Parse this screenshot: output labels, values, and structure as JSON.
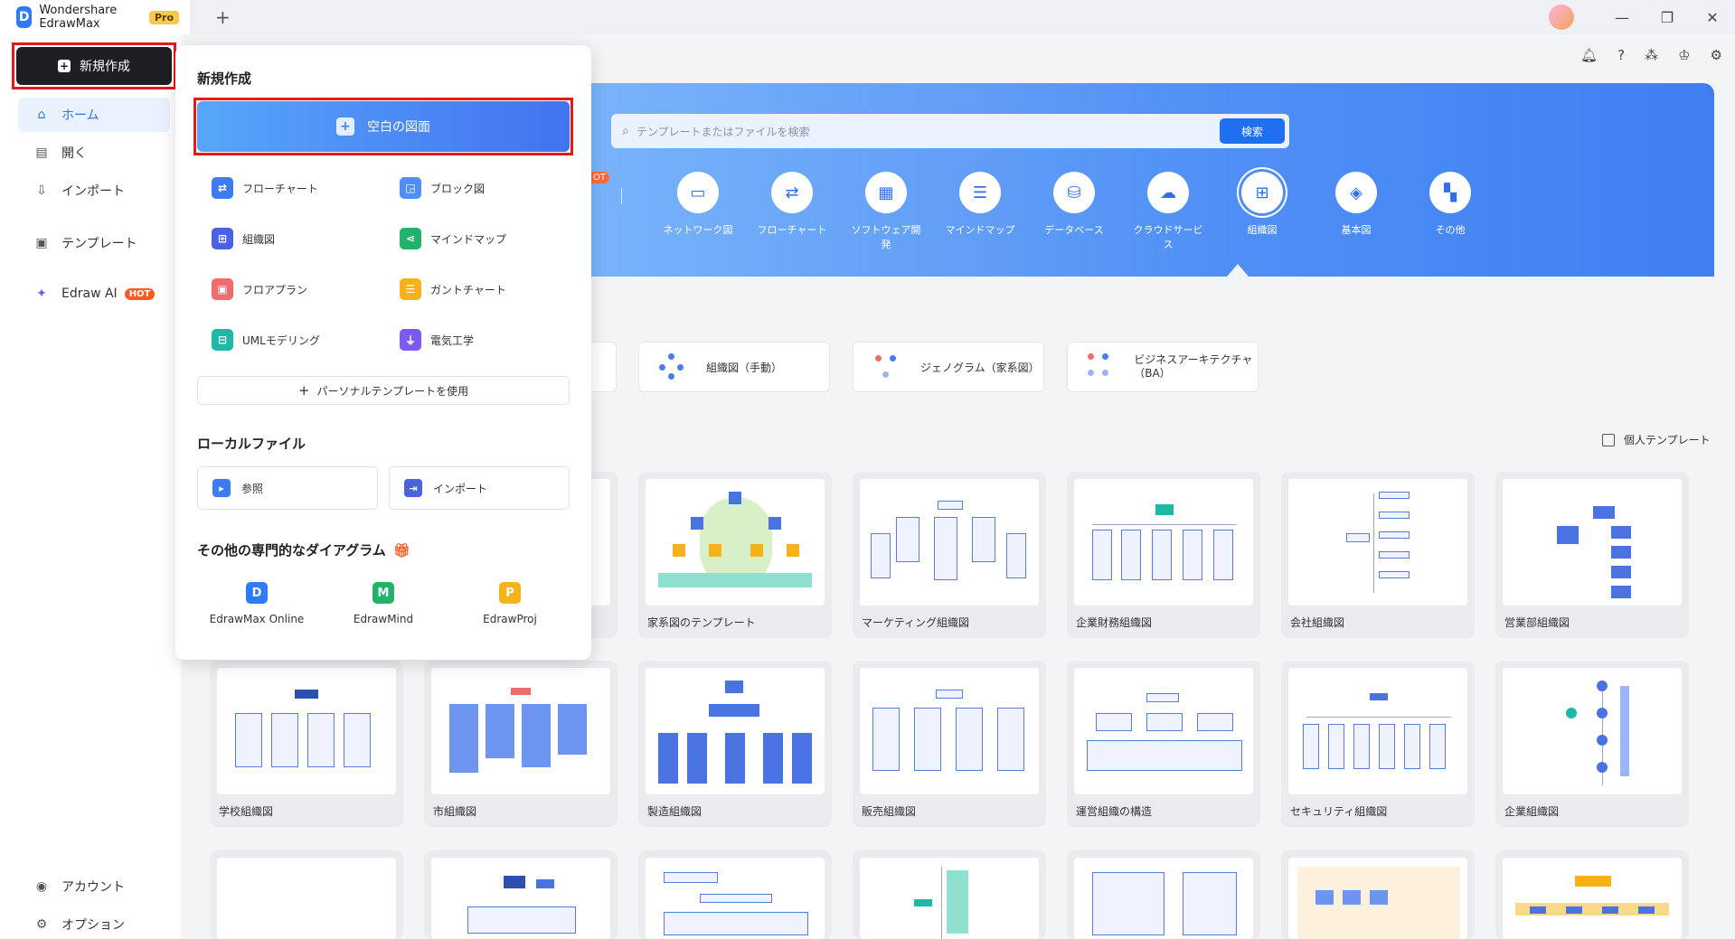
{
  "titlebar": {
    "app_name": "Wondershare EdrawMax",
    "pro": "Pro",
    "newtab": "+"
  },
  "sidebar": {
    "new_button": "新規作成",
    "items": [
      {
        "label": "ホーム",
        "icon": "home-icon"
      },
      {
        "label": "開く",
        "icon": "file-open-icon"
      },
      {
        "label": "インポート",
        "icon": "import-icon"
      },
      {
        "label": "テンプレート",
        "icon": "template-icon"
      },
      {
        "label": "Edraw AI",
        "icon": "ai-icon",
        "badge": "HOT"
      },
      {
        "label": "アカウント",
        "icon": "account-icon"
      },
      {
        "label": "オプション",
        "icon": "gear-icon"
      }
    ]
  },
  "hero": {
    "search_placeholder": "テンプレートまたはファイルを検索",
    "search_button": "検索",
    "categories": [
      {
        "label": "ネットワーク図",
        "icon": "network-icon"
      },
      {
        "label": "フローチャート",
        "icon": "flowchart-icon"
      },
      {
        "label": "ソフトウェア開\n発",
        "icon": "software-icon"
      },
      {
        "label": "マインドマップ",
        "icon": "mindmap-icon"
      },
      {
        "label": "データベース",
        "icon": "database-icon"
      },
      {
        "label": "クラウドサービ\nス",
        "icon": "cloud-icon"
      },
      {
        "label": "組織図",
        "icon": "org-chart-icon",
        "selected": true
      },
      {
        "label": "基本図",
        "icon": "basic-diagram-icon"
      },
      {
        "label": "その他",
        "icon": "grid-icon"
      }
    ]
  },
  "subtypes": [
    "組織図（手動）",
    "ジェノグラム（家系図）",
    "ビジネスアーキテクチャ（BA）"
  ],
  "personal_templates": "個人テンプレート",
  "templates_row1": [
    "家系図のテンプレート",
    "マーケティング組織図",
    "企業財務組織図",
    "会社組織図",
    "営業部組織図"
  ],
  "templates_row2": [
    "学校組織図",
    "市組織図",
    "製造組織図",
    "販売組織図",
    "運営組織の構造",
    "セキュリティ組織図",
    "企業組織図"
  ],
  "popup": {
    "title": "新規作成",
    "blank": "空白の図面",
    "types": [
      {
        "label": "フローチャート",
        "color": "#3e7bf0"
      },
      {
        "label": "ブロック図",
        "color": "#4f8ff5"
      },
      {
        "label": "組織図",
        "color": "#4a62e0"
      },
      {
        "label": "マインドマップ",
        "color": "#23b26b"
      },
      {
        "label": "フロアプラン",
        "color": "#f06b6b"
      },
      {
        "label": "ガントチャート",
        "color": "#f5b21a"
      },
      {
        "label": "UMLモデリング",
        "color": "#1cb8a8"
      },
      {
        "label": "電気工学",
        "color": "#7a5af0"
      }
    ],
    "personal_template": "パーソナルテンプレートを使用",
    "local_title": "ローカルファイル",
    "browse": "参照",
    "import": "インポート",
    "pro_title": "その他の専門的なダイアグラム",
    "products": [
      "EdrawMax Online",
      "EdrawMind",
      "EdrawProj"
    ]
  }
}
